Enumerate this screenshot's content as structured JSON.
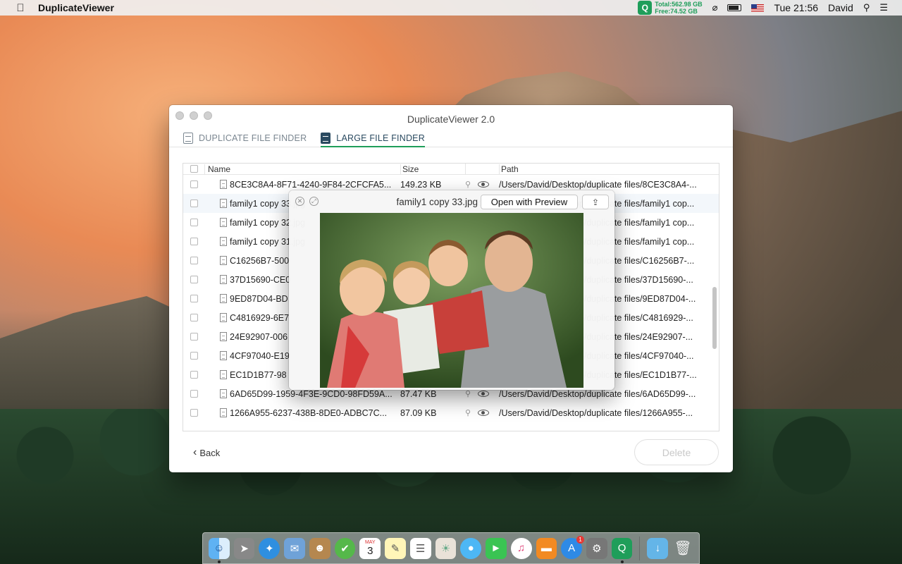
{
  "menubar": {
    "app_name": "DuplicateViewer",
    "disk_total": "Total:562.98 GB",
    "disk_free": "Free:74.52 GB",
    "clock": "Tue 21:56",
    "user": "David"
  },
  "window": {
    "title": "DuplicateViewer 2.0",
    "tabs": [
      {
        "label": "DUPLICATE FILE FINDER"
      },
      {
        "label": "LARGE FILE FINDER"
      }
    ],
    "columns": {
      "name": "Name",
      "size": "Size",
      "path": "Path"
    },
    "rows": [
      {
        "name": "8CE3C8A4-8F71-4240-9F84-2CFCFA5...",
        "size": "149.23 KB",
        "path": "/Users/David/Desktop/duplicate files/8CE3C8A4-..."
      },
      {
        "name": "family1 copy 33.jpg",
        "size": "",
        "path": "/Users/David/Desktop/duplicate files/family1 cop..."
      },
      {
        "name": "family1 copy 32.jpg",
        "size": "",
        "path": "/Users/David/Desktop/duplicate files/family1 cop..."
      },
      {
        "name": "family1 copy 31.jpg",
        "size": "",
        "path": "/Users/David/Desktop/duplicate files/family1 cop..."
      },
      {
        "name": "C16256B7-500",
        "size": "",
        "path": "/Users/David/Desktop/duplicate files/C16256B7-..."
      },
      {
        "name": "37D15690-CE0",
        "size": "",
        "path": "/Users/David/Desktop/duplicate files/37D15690-..."
      },
      {
        "name": "9ED87D04-BD",
        "size": "",
        "path": "/Users/David/Desktop/duplicate files/9ED87D04-..."
      },
      {
        "name": "C4816929-6E7",
        "size": "",
        "path": "/Users/David/Desktop/duplicate files/C4816929-..."
      },
      {
        "name": "24E92907-006",
        "size": "",
        "path": "/Users/David/Desktop/duplicate files/24E92907-..."
      },
      {
        "name": "4CF97040-E19",
        "size": "",
        "path": "/Users/David/Desktop/duplicate files/4CF97040-..."
      },
      {
        "name": "EC1D1B77-98",
        "size": "",
        "path": "/Users/David/Desktop/duplicate files/EC1D1B77-..."
      },
      {
        "name": "6AD65D99-1959-4F3E-9CD0-98FD59A...",
        "size": "87.47 KB",
        "path": "/Users/David/Desktop/duplicate files/6AD65D99-..."
      },
      {
        "name": "1266A955-6237-438B-8DE0-ADBC7C...",
        "size": "87.09 KB",
        "path": "/Users/David/Desktop/duplicate files/1266A955-..."
      }
    ],
    "back_label": "Back",
    "delete_label": "Delete"
  },
  "quicklook": {
    "filename": "family1 copy 33.jpg",
    "open_with_label": "Open with Preview"
  },
  "dock": {
    "calendar_month": "MAY",
    "calendar_day": "3",
    "appstore_badge": "1"
  }
}
